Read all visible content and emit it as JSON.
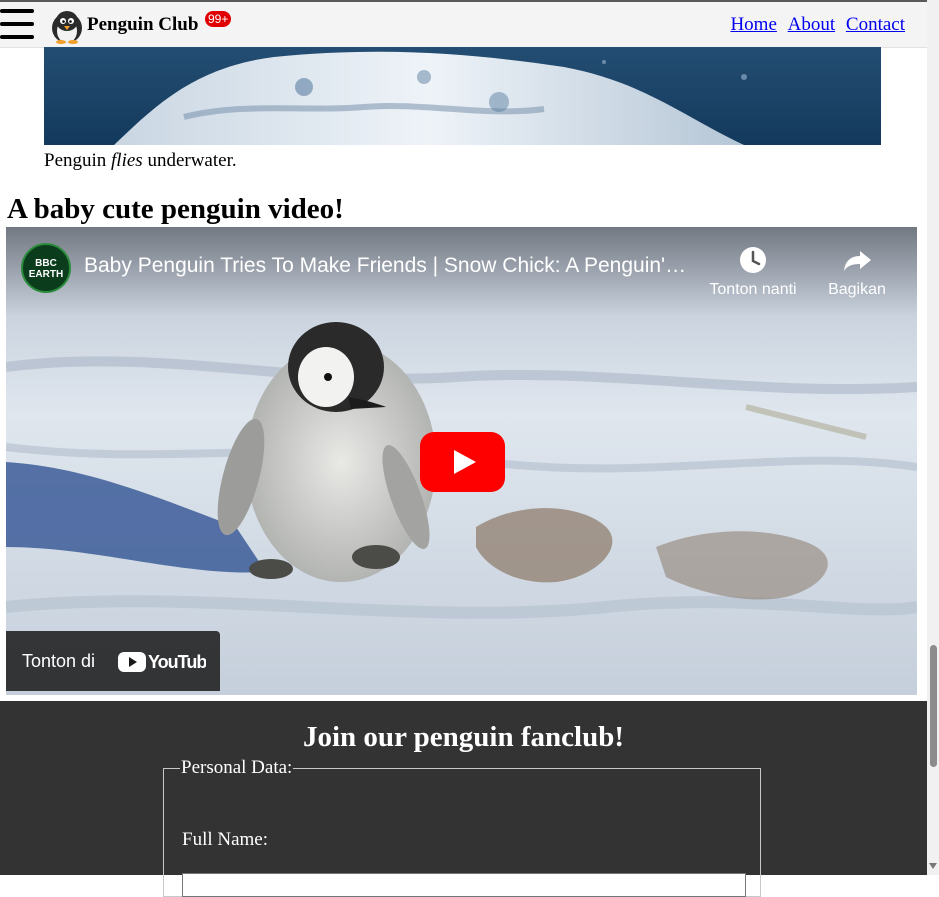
{
  "header": {
    "brand": "Penguin Club",
    "badge": "99+",
    "nav": [
      "Home",
      "About",
      "Contact"
    ]
  },
  "photo": {
    "caption_prefix": "Penguin",
    "caption_emphasis": "flies",
    "caption_suffix": "underwater."
  },
  "video_section": {
    "heading": "A baby cute penguin video!"
  },
  "video": {
    "channel_logo_text": "BBC EARTH",
    "title": "Baby Penguin Tries To Make Friends | Snow Chick: A Penguin's Tale | BBC Earth",
    "watch_later": "Tonton nanti",
    "share": "Bagikan",
    "watch_on": "Tonton di",
    "platform": "YouTube",
    "play_color": "#ff0000"
  },
  "fanclub": {
    "heading": "Join our penguin fanclub!",
    "legend": "Personal Data:",
    "full_name_label": "Full Name:",
    "full_name_value": ""
  }
}
